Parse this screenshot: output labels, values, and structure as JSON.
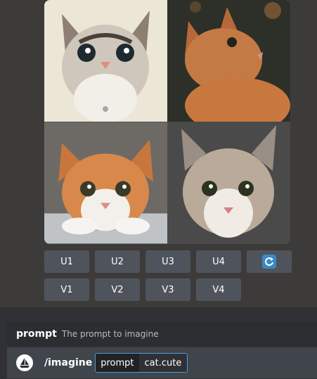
{
  "images": {
    "alt": [
      "cute kitten portrait 1",
      "cute kitten portrait 2",
      "cute kitten portrait 3",
      "cute kitten portrait 4"
    ]
  },
  "buttons": {
    "upscale": [
      "U1",
      "U2",
      "U3",
      "U4"
    ],
    "variation": [
      "V1",
      "V2",
      "V3",
      "V4"
    ],
    "reroll_icon": "refresh-icon"
  },
  "hint": {
    "name": "prompt",
    "description": "The prompt to imagine"
  },
  "composer": {
    "command": "/imagine",
    "option_name": "prompt",
    "option_value": "cat.cute"
  },
  "colors": {
    "button": "#4f545c",
    "accent": "#3b88c3",
    "background": "#3d3b39"
  }
}
